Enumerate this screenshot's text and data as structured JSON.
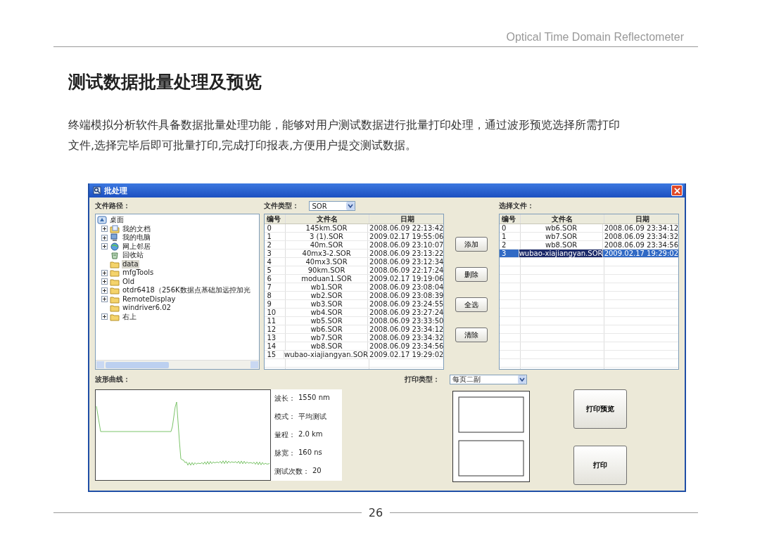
{
  "header": {
    "title": "Optical Time Domain Reflectometer"
  },
  "heading": "测试数据批量处理及预览",
  "paragraph": "终端模拟分析软件具备数据批量处理功能，能够对用户测试数据进行批量打印处理，通过波形预览选择所需打印文件,选择完毕后即可批量打印,完成打印报表,方便用户提交测试数据。",
  "window": {
    "title": "批处理"
  },
  "tree": {
    "label": "文件路径：",
    "items": [
      {
        "label": "桌面",
        "kind": "desktop",
        "expandable": false,
        "selected": false,
        "children": [
          {
            "label": "我的文档",
            "kind": "documents",
            "expandable": true,
            "selected": false
          },
          {
            "label": "我的电脑",
            "kind": "computer",
            "expandable": true,
            "selected": false
          },
          {
            "label": "网上邻居",
            "kind": "network",
            "expandable": true,
            "selected": false
          },
          {
            "label": "回收站",
            "kind": "recycle",
            "expandable": false,
            "selected": false
          },
          {
            "label": "data",
            "kind": "folder",
            "expandable": false,
            "selected": true
          },
          {
            "label": "mfgTools",
            "kind": "folder",
            "expandable": true,
            "selected": false
          },
          {
            "label": "Old",
            "kind": "folder",
            "expandable": true,
            "selected": false
          },
          {
            "label": "otdr6418（256K数据点基础加远控加光",
            "kind": "folder",
            "expandable": true,
            "selected": false
          },
          {
            "label": "RemoteDisplay",
            "kind": "folder",
            "expandable": true,
            "selected": false
          },
          {
            "label": "windriver6.02",
            "kind": "folder",
            "expandable": false,
            "selected": false
          },
          {
            "label": "右上",
            "kind": "folder",
            "expandable": true,
            "selected": false
          }
        ]
      }
    ]
  },
  "file_type": {
    "label": "文件类型：",
    "value": "SOR"
  },
  "file_list": {
    "columns": [
      "编号",
      "文件名",
      "日期"
    ],
    "rows": [
      {
        "cells": [
          "0",
          "145km.SOR",
          "2008.06.09 22:13:42"
        ],
        "selected": false
      },
      {
        "cells": [
          "1",
          "3 (1).SOR",
          "2009.02.17 19:55:06"
        ],
        "selected": false
      },
      {
        "cells": [
          "2",
          "40m.SOR",
          "2008.06.09 23:10:07"
        ],
        "selected": false
      },
      {
        "cells": [
          "3",
          "40mx3-2.SOR",
          "2008.06.09 23:13:22"
        ],
        "selected": false
      },
      {
        "cells": [
          "4",
          "40mx3.SOR",
          "2008.06.09 23:12:34"
        ],
        "selected": false
      },
      {
        "cells": [
          "5",
          "90km.SOR",
          "2008.06.09 22:17:24"
        ],
        "selected": false
      },
      {
        "cells": [
          "6",
          "moduan1.SOR",
          "2009.02.17 19:19:06"
        ],
        "selected": false
      },
      {
        "cells": [
          "7",
          "wb1.SOR",
          "2008.06.09 23:08:04"
        ],
        "selected": false
      },
      {
        "cells": [
          "8",
          "wb2.SOR",
          "2008.06.09 23:08:39"
        ],
        "selected": false
      },
      {
        "cells": [
          "9",
          "wb3.SOR",
          "2008.06.09 23:24:55"
        ],
        "selected": false
      },
      {
        "cells": [
          "10",
          "wb4.SOR",
          "2008.06.09 23:27:24"
        ],
        "selected": false
      },
      {
        "cells": [
          "11",
          "wb5.SOR",
          "2008.06.09 23:33:50"
        ],
        "selected": false
      },
      {
        "cells": [
          "12",
          "wb6.SOR",
          "2008.06.09 23:34:12"
        ],
        "selected": false
      },
      {
        "cells": [
          "13",
          "wb7.SOR",
          "2008.06.09 23:34:32"
        ],
        "selected": false
      },
      {
        "cells": [
          "14",
          "wb8.SOR",
          "2008.06.09 23:34:56"
        ],
        "selected": false
      },
      {
        "cells": [
          "15",
          "wubao-xiajiangyan.SOR",
          "2009.02.17 19:29:02"
        ],
        "selected": false
      }
    ]
  },
  "buttons": [
    "添加",
    "删除",
    "全选",
    "清除"
  ],
  "selected_files": {
    "label": "选择文件：",
    "columns": [
      "编号",
      "文件名",
      "日期"
    ],
    "rows": [
      {
        "cells": [
          "0",
          "wb6.SOR",
          "2008.06.09 23:34:12"
        ],
        "selected": false
      },
      {
        "cells": [
          "1",
          "wb7.SOR",
          "2008.06.09 23:34:32"
        ],
        "selected": false
      },
      {
        "cells": [
          "2",
          "wb8.SOR",
          "2008.06.09 23:34:56"
        ],
        "selected": false
      },
      {
        "cells": [
          "3",
          "wubao-xiajiangyan.SOR",
          "2009.02.17 19:29:02"
        ],
        "selected": true
      }
    ]
  },
  "waveform": {
    "label": "波形曲线："
  },
  "info": [
    {
      "label": "波长：",
      "value": "1550 nm"
    },
    {
      "label": "模式：",
      "value": "平均测试"
    },
    {
      "label": "量程：",
      "value": "2.0 km"
    },
    {
      "label": "脉宽：",
      "value": "160 ns"
    },
    {
      "label": "测试次数：",
      "value": "20"
    }
  ],
  "print_type": {
    "label": "打印类型：",
    "value": "每页二副"
  },
  "print_buttons": [
    "打印预览",
    "打印"
  ],
  "footer": {
    "page_number": "26"
  }
}
